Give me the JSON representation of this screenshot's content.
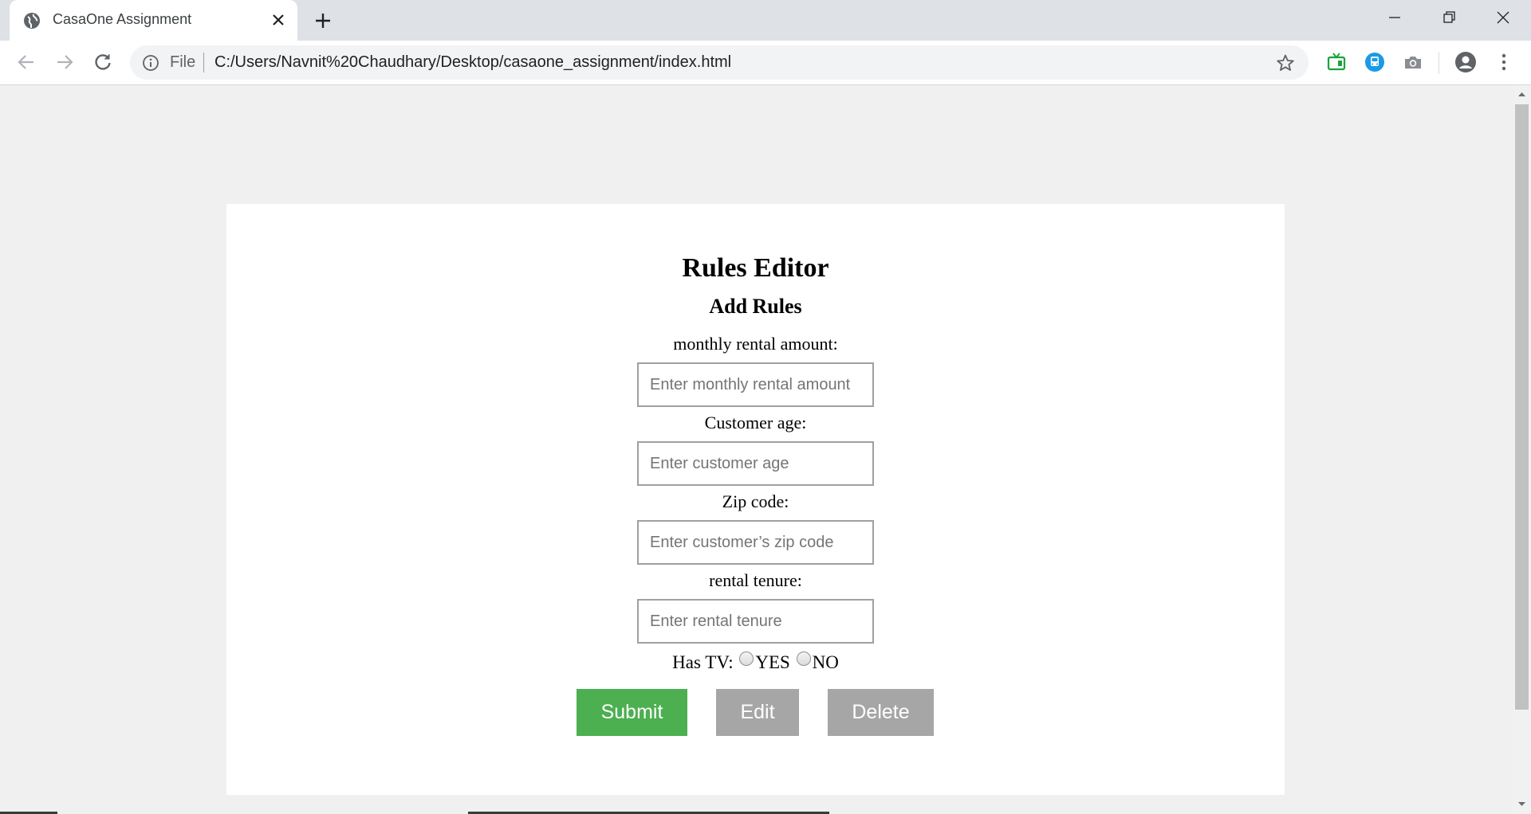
{
  "browser": {
    "tab_title": "CasaOne Assignment",
    "address_scheme_label": "File",
    "address_url": "C:/Users/Navnit%20Chaudhary/Desktop/casaone_assignment/index.html"
  },
  "page": {
    "title": "Rules Editor",
    "subtitle": "Add Rules",
    "fields": [
      {
        "label": "monthly rental amount:",
        "placeholder": "Enter monthly rental amount",
        "value": ""
      },
      {
        "label": "Customer age:",
        "placeholder": "Enter customer age",
        "value": ""
      },
      {
        "label": "Zip code:",
        "placeholder": "Enter customer’s zip code",
        "value": ""
      },
      {
        "label": "rental tenure:",
        "placeholder": "Enter rental tenure",
        "value": ""
      }
    ],
    "has_tv": {
      "label": "Has TV:",
      "options": [
        "YES",
        "NO"
      ],
      "selected": ""
    },
    "buttons": {
      "submit": "Submit",
      "edit": "Edit",
      "delete": "Delete"
    }
  },
  "colors": {
    "submit_bg": "#4caf50",
    "secondary_btn_bg": "#a6a6a6",
    "page_bg": "#f0f0f0",
    "card_bg": "#ffffff"
  },
  "icons": {
    "tab": "globe-icon",
    "close": "close-icon",
    "new_tab": "plus-icon",
    "back": "back-arrow-icon",
    "forward": "forward-arrow-icon",
    "reload": "reload-icon",
    "info": "info-icon",
    "bookmark": "star-icon",
    "extension_1": "tv-extension-icon",
    "extension_2": "bus-extension-icon",
    "extension_3": "camera-extension-icon",
    "profile": "account-icon",
    "menu": "kebab-menu-icon"
  }
}
